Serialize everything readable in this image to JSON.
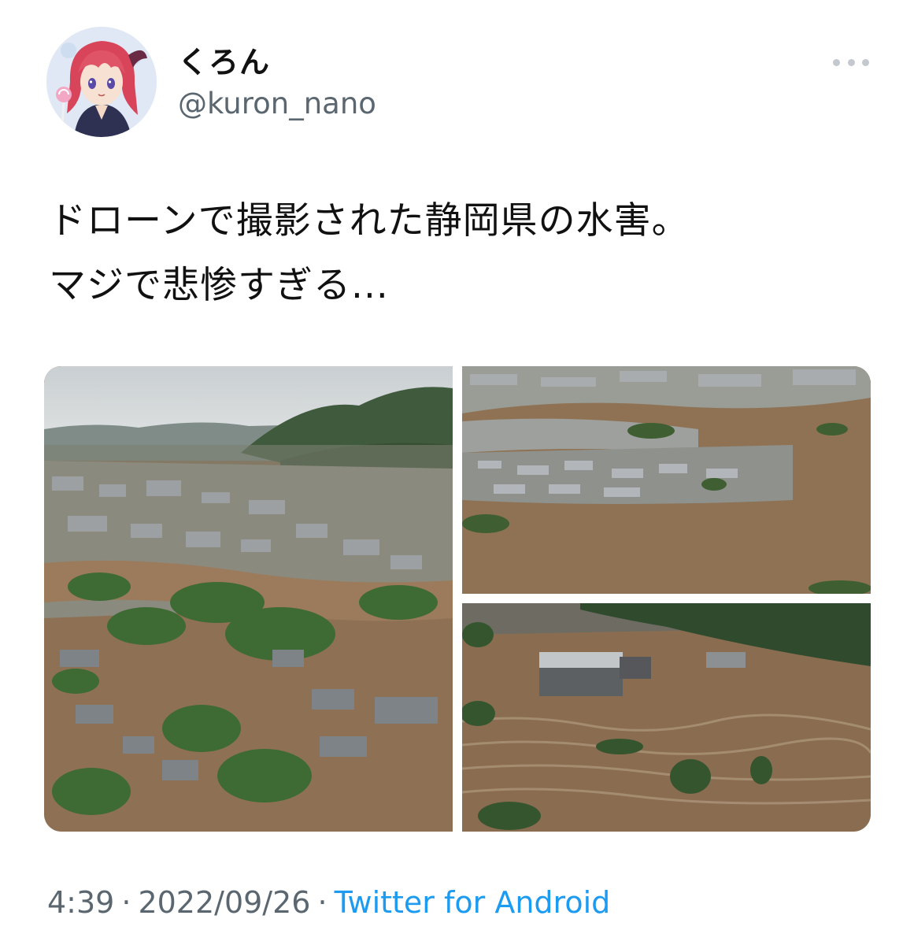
{
  "tweet": {
    "author": {
      "display_name": "くろん",
      "handle": "@kuron_nano",
      "avatar_icon": "avatar-anime-girl"
    },
    "more_icon": "more-horizontal-icon",
    "text_lines": [
      "ドローンで撮影された静岡県の水害。",
      "マジで悲惨すぎる..."
    ],
    "media_count": 3,
    "time": "4:39",
    "separator": "·",
    "date": "2022/09/26",
    "source": "Twitter for Android"
  },
  "colors": {
    "text": "#111111",
    "secondary": "#5b6770",
    "link": "#1d9bf0",
    "flood_water": "#8d6f52"
  }
}
